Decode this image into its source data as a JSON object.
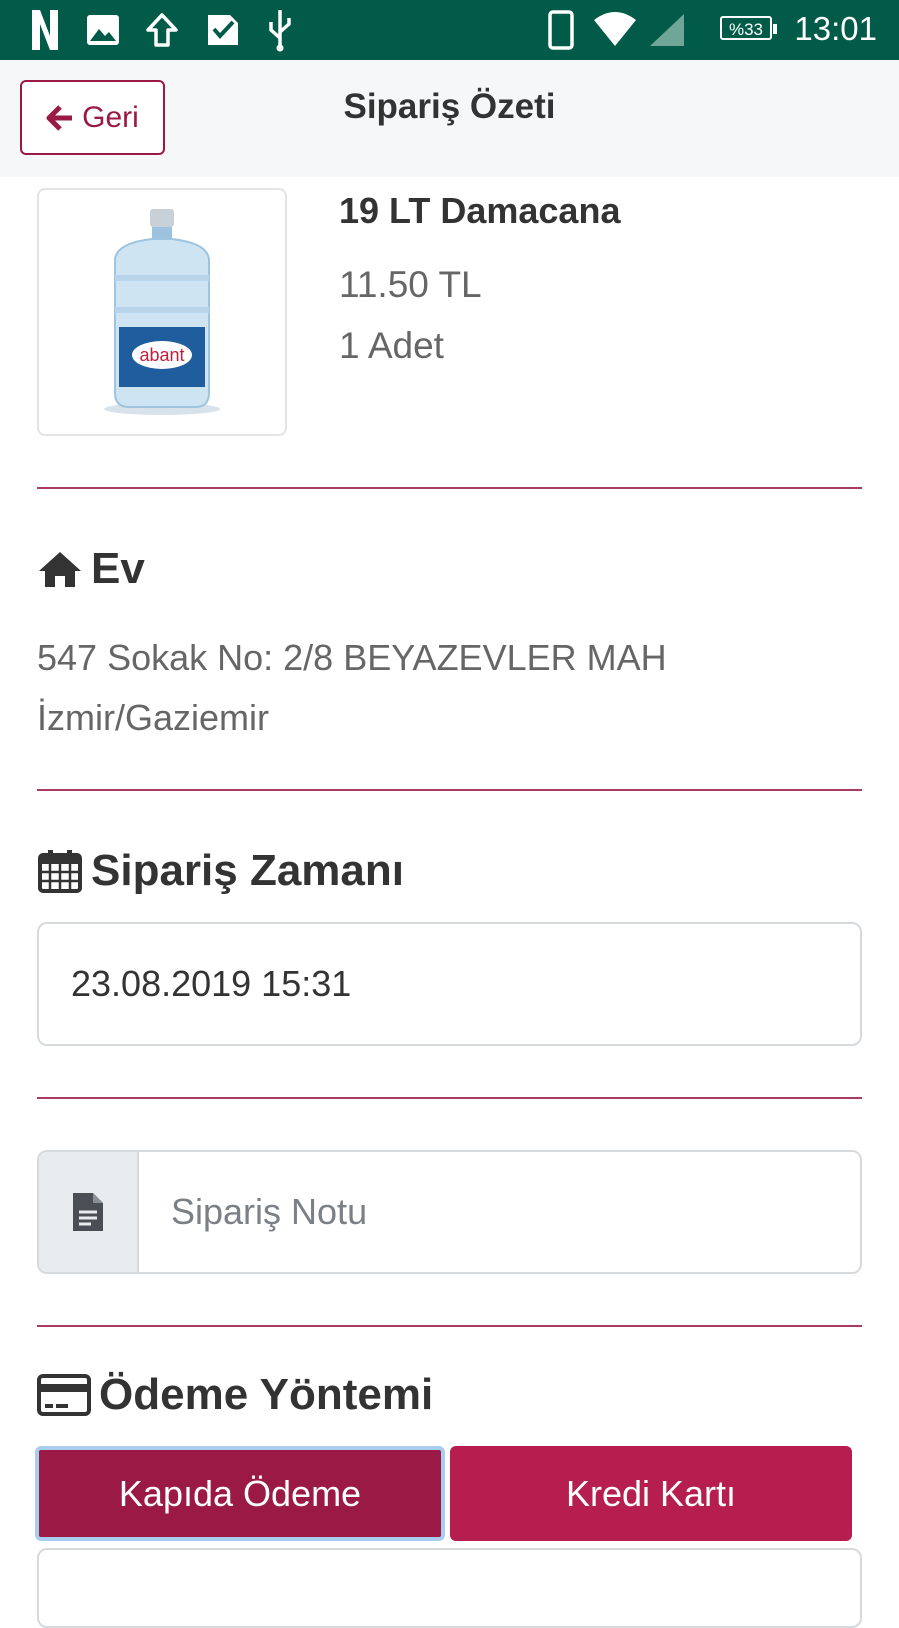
{
  "status_bar": {
    "time": "13:01",
    "battery": "%33",
    "left_icons": [
      "netflix-n-icon",
      "gallery-icon",
      "upload-icon",
      "check-icon",
      "usb-icon"
    ],
    "right_icons": [
      "phone-icon",
      "wifi-icon",
      "signal-icon",
      "battery-icon"
    ]
  },
  "header": {
    "back_label": "Geri",
    "title": "Sipariş Özeti"
  },
  "product": {
    "name": "19 LT Damacana",
    "price": "11.50 TL",
    "quantity": "1 Adet",
    "brand_on_image": "abant"
  },
  "address": {
    "heading": "Ev",
    "line1": "547 Sokak No: 2/8 BEYAZEVLER MAH",
    "line2": "İzmir/Gaziemir"
  },
  "order_time": {
    "heading": "Sipariş Zamanı",
    "value": "23.08.2019 15:31"
  },
  "order_note": {
    "placeholder": "Sipariş Notu"
  },
  "payment": {
    "heading": "Ödeme Yöntemi",
    "options": [
      "Kapıda Ödeme",
      "Kredi Kartı"
    ],
    "selected": "Kapıda Ödeme"
  },
  "colors": {
    "status_bar": "#025b49",
    "accent": "#9b1a45",
    "accent_light": "#b51e4e"
  }
}
